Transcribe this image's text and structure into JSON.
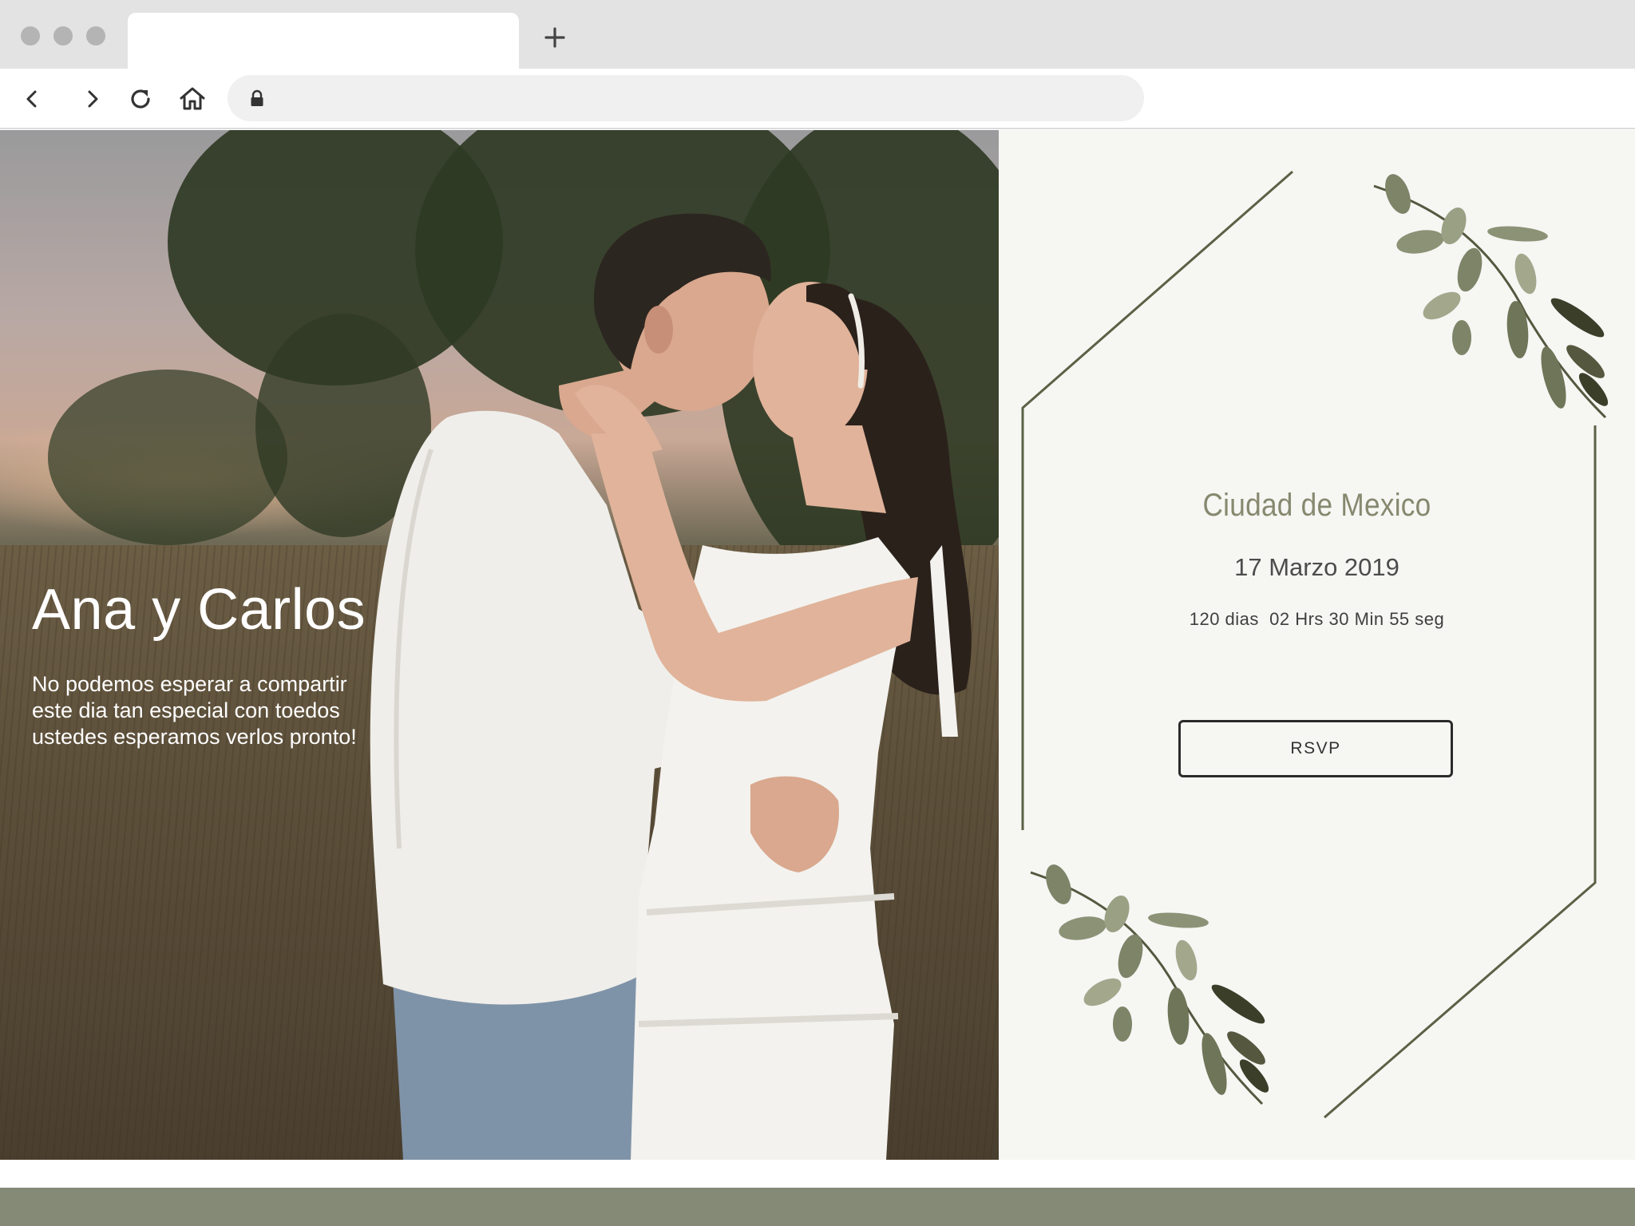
{
  "browser": {
    "tab_title": "",
    "url": "",
    "icons": {
      "back": "chevron-left-icon",
      "forward": "chevron-right-icon",
      "reload": "reload-icon",
      "home": "home-icon",
      "lock": "lock-icon",
      "new_tab": "plus-icon"
    }
  },
  "hero": {
    "title": "Ana y Carlos",
    "message_lines": [
      "No podemos esperar  a compartir",
      "este dia tan especial con toedos",
      "ustedes esperamos verlos pronto!"
    ]
  },
  "invitation": {
    "city": "Ciudad de Mexico",
    "date": "17 Marzo 2019",
    "countdown": "120 dias  02 Hrs 30 Min 55 seg",
    "rsvp_label": "RSVP"
  },
  "colors": {
    "accent_olive": "#87896f",
    "footer": "#858a77",
    "card_background": "#f6f6f3",
    "leaf": "#7d8468"
  }
}
